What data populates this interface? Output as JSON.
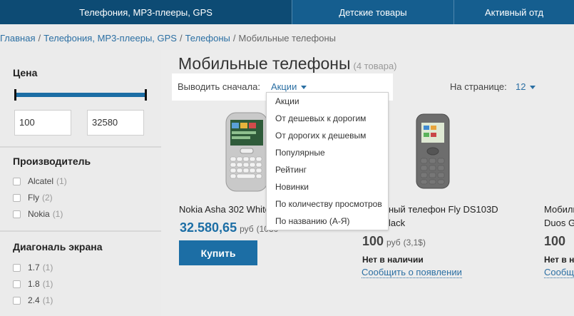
{
  "topnav": {
    "items": [
      "Телефония, MP3-плееры, GPS",
      "Детские товары",
      "Активный отд"
    ]
  },
  "breadcrumb": {
    "items": [
      "Главная",
      "Телефония, MP3-плееры, GPS",
      "Телефоны"
    ],
    "current": "Мобильные телефоны",
    "separator": "/"
  },
  "sidebar": {
    "price": {
      "title": "Цена",
      "min": "100",
      "max": "32580"
    },
    "manufacturer": {
      "title": "Производитель",
      "items": [
        {
          "label": "Alcatel",
          "count": "(1)"
        },
        {
          "label": "Fly",
          "count": "(2)"
        },
        {
          "label": "Nokia",
          "count": "(1)"
        }
      ]
    },
    "diagonal": {
      "title": "Диагональ экрана",
      "items": [
        {
          "label": "1.7",
          "count": "(1)"
        },
        {
          "label": "1.8",
          "count": "(1)"
        },
        {
          "label": "2.4",
          "count": "(1)"
        }
      ]
    }
  },
  "main": {
    "title": "Мобильные телефоны",
    "goods_count": "(4 товара)",
    "sort_label": "Выводить сначала:",
    "sort_value": "Акции",
    "perpage_label": "На странице:",
    "perpage_value": "12",
    "sort_options": [
      "Акции",
      "От дешевых к дорогим",
      "От дорогих к дешевым",
      "Популярные",
      "Рейтинг",
      "Новинки",
      "По количеству просмотров",
      "По названию (А-Я)"
    ]
  },
  "products": [
    {
      "name": "Nokia Asha 302 White",
      "price": "32.580,65",
      "currency": "руб",
      "price_extra": "(1030",
      "buy_label": "Купить"
    },
    {
      "name_line1": "ный телефон Fly DS103D",
      "name_line2": "lack",
      "price": "100",
      "currency": "руб",
      "price_extra": "(3,1$)",
      "stock": "Нет в наличии",
      "notify": "Сообщить о появлении"
    },
    {
      "name_line1": "Мобиль",
      "name_line2": "Duos G",
      "price": "100",
      "stock": "Нет в н",
      "notify": "Сообщит"
    }
  ],
  "colors": {
    "nav_bg": "#155e8f",
    "accent": "#1c6ea5",
    "link": "#2b6fa3"
  }
}
